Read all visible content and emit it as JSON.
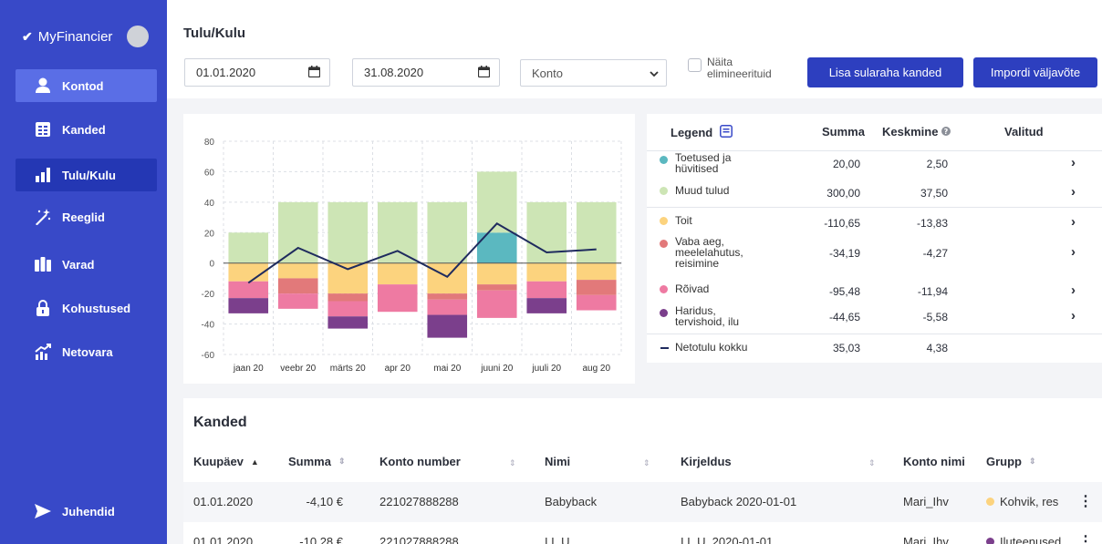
{
  "sidebar": {
    "brand": "MyFinancier",
    "items": [
      {
        "label": "Kontod",
        "icon": "user-icon"
      },
      {
        "label": "Kanded",
        "icon": "ledger-icon"
      },
      {
        "label": "Tulu/Kulu",
        "icon": "bar-chart-icon"
      },
      {
        "label": "Reeglid",
        "icon": "magic-wand-icon"
      },
      {
        "label": "Varad",
        "icon": "assets-icon"
      },
      {
        "label": "Kohustused",
        "icon": "lock-icon"
      },
      {
        "label": "Netovara",
        "icon": "growth-chart-icon"
      }
    ],
    "guides": {
      "label": "Juhendid",
      "icon": "send-icon"
    }
  },
  "header": {
    "title": "Tulu/Kulu",
    "date_from": "01.01.2020",
    "date_to": "31.08.2020",
    "account_select": "Konto",
    "show_eliminated": "Näita elimineerituid",
    "add_cash_button": "Lisa sularaha kanded",
    "import_button": "Impordi väljavõte"
  },
  "legend": {
    "title": "Legend",
    "col_sum": "Summa",
    "col_avg": "Keskmine",
    "col_selected": "Valitud",
    "rows": [
      {
        "name": "Toetused ja hüvitised",
        "sum": "20,00",
        "avg": "2,50",
        "color": "#5bb8c0"
      },
      {
        "name": "Muud tulud",
        "sum": "300,00",
        "avg": "37,50",
        "color": "#cde5b5"
      },
      {
        "name": "Toit",
        "sum": "-110,65",
        "avg": "-13,83",
        "color": "#fcd37e"
      },
      {
        "name": "Vaba aeg, meelelahutus, reisimine",
        "sum": "-34,19",
        "avg": "-4,27",
        "color": "#e2797a"
      },
      {
        "name": "Rõivad",
        "sum": "-95,48",
        "avg": "-11,94",
        "color": "#ee7aa2"
      },
      {
        "name": "Haridus, tervishoid, ilu",
        "sum": "-44,65",
        "avg": "-5,58",
        "color": "#7b3f8c"
      },
      {
        "name": "Netotulu kokku",
        "sum": "35,03",
        "avg": "4,38",
        "color": "#1f2b5e"
      }
    ]
  },
  "chart_data": {
    "type": "bar",
    "categories": [
      "jaan 20",
      "veebr 20",
      "märts 20",
      "apr 20",
      "mai 20",
      "juuni 20",
      "juuli 20",
      "aug 20"
    ],
    "ylim": [
      -60,
      80
    ],
    "yticks": [
      -60,
      -40,
      -20,
      0,
      20,
      40,
      60,
      80
    ],
    "grid": true,
    "series": [
      {
        "name": "Toetused ja hüvitised",
        "color": "#5bb8c0",
        "values": [
          0,
          0,
          0,
          0,
          0,
          20,
          0,
          0
        ]
      },
      {
        "name": "Muud tulud",
        "color": "#cde5b5",
        "values": [
          20,
          40,
          40,
          40,
          40,
          40,
          40,
          40
        ]
      },
      {
        "name": "Toit",
        "color": "#fcd37e",
        "values": [
          -12,
          -10,
          -20,
          -14,
          -20,
          -14,
          -12,
          -11
        ]
      },
      {
        "name": "Vaba aeg, meelelahutus, reisimine",
        "color": "#e2797a",
        "values": [
          0,
          -10,
          -5,
          0,
          -4,
          -4,
          0,
          -10
        ]
      },
      {
        "name": "Rõivad",
        "color": "#ee7aa2",
        "values": [
          -11,
          -10,
          -10,
          -18,
          -10,
          -18,
          -11,
          -10
        ]
      },
      {
        "name": "Haridus, tervishoid, ilu",
        "color": "#7b3f8c",
        "values": [
          -10,
          0,
          -8,
          0,
          -15,
          0,
          -10,
          0
        ]
      }
    ],
    "line": {
      "name": "Netotulu kokku",
      "color": "#1f2b5e",
      "values": [
        -13,
        10,
        -4,
        8,
        -9,
        26,
        7,
        9
      ]
    }
  },
  "table": {
    "title": "Kanded",
    "columns": [
      "Kuupäev",
      "Summa",
      "Konto number",
      "Nimi",
      "Kirjeldus",
      "Konto nimi",
      "Grupp"
    ],
    "rows": [
      {
        "date": "01.01.2020",
        "sum": "-4,10 €",
        "account": "221027888288",
        "name": "Babyback",
        "desc": "Babyback 2020-01-01",
        "acct_name": "Mari_Ihv",
        "group": "Kohvik, res",
        "group_color": "#fcd37e"
      },
      {
        "date": "01.01.2020",
        "sum": "-10,28 €",
        "account": "221027888288",
        "name": "I.L.U.",
        "desc": "I.L.U. 2020-01-01",
        "acct_name": "Mari_Ihv",
        "group": "Iluteenused",
        "group_color": "#7b3f8c"
      }
    ]
  }
}
